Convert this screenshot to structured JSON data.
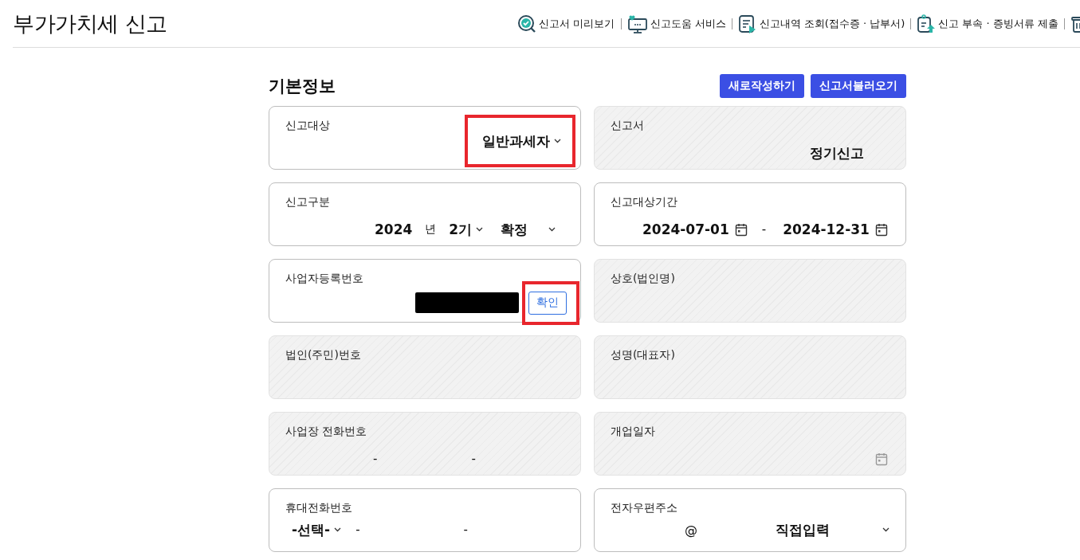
{
  "page": {
    "title": "부가가치세 신고"
  },
  "toolbar": [
    {
      "kind": "preview",
      "label": "신고서 미리보기"
    },
    {
      "kind": "help",
      "label": "신고도움 서비스"
    },
    {
      "kind": "history",
      "label": "신고내역 조회(접수증 · 납부서)"
    },
    {
      "kind": "upload",
      "label": "신고 부속 · 증빙서류 제출"
    },
    {
      "kind": "trash"
    }
  ],
  "section": {
    "title": "기본정보",
    "buttons": [
      "새로작성하기",
      "신고서불러오기"
    ]
  },
  "fields": [
    {
      "kind": "select",
      "label": "신고대상",
      "value": "일반과세자",
      "disabled": false,
      "highlighted": true
    },
    {
      "kind": "text",
      "label": "신고서",
      "value": "정기신고",
      "disabled": true
    },
    {
      "kind": "period",
      "label": "신고구분",
      "year": "2024",
      "year_unit": "년",
      "term": "2기",
      "type": "확정",
      "disabled": false
    },
    {
      "kind": "date_range",
      "label": "신고대상기간",
      "start": "2024-07-01",
      "separator": "-",
      "end": "2024-12-31",
      "disabled": false
    },
    {
      "kind": "business_no",
      "label": "사업자등록번호",
      "button": "확인",
      "disabled": false,
      "highlighted": true
    },
    {
      "kind": "text",
      "label": "상호(법인명)",
      "disabled": true
    },
    {
      "kind": "text",
      "label": "법인(주민)번호",
      "disabled": true
    },
    {
      "kind": "text",
      "label": "성명(대표자)",
      "disabled": true
    },
    {
      "kind": "phone",
      "label": "사업장 전화번호",
      "separators": [
        "-",
        "-"
      ],
      "disabled": true
    },
    {
      "kind": "date",
      "label": "개업일자",
      "disabled": true
    },
    {
      "kind": "mobile",
      "label": "휴대전화번호",
      "prefix": "-선택-",
      "separators": [
        "-",
        "-"
      ],
      "disabled": false
    },
    {
      "kind": "email",
      "label": "전자우편주소",
      "at": "@",
      "domain": "직접입력",
      "disabled": false
    }
  ]
}
